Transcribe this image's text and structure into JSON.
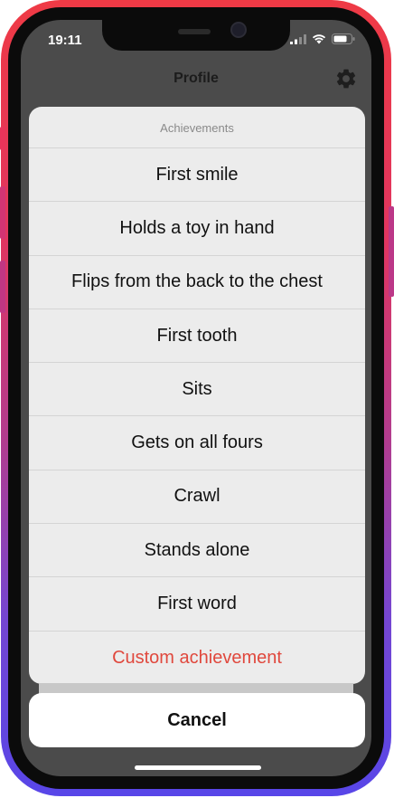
{
  "status_bar": {
    "time": "19:11",
    "icons": [
      "signal-icon",
      "wifi-icon",
      "battery-icon"
    ]
  },
  "nav": {
    "title": "Profile",
    "settings_icon": "gear-icon"
  },
  "action_sheet": {
    "title": "Achievements",
    "items": [
      {
        "label": "First smile"
      },
      {
        "label": "Holds a toy in hand"
      },
      {
        "label": "Flips from the back to the chest"
      },
      {
        "label": "First tooth"
      },
      {
        "label": "Sits"
      },
      {
        "label": "Gets on all fours"
      },
      {
        "label": "Crawl"
      },
      {
        "label": "Stands alone"
      },
      {
        "label": "First word"
      }
    ],
    "custom_label": "Custom achievement",
    "cancel_label": "Cancel"
  },
  "colors": {
    "destructive": "#e0483d",
    "frame_gradient_top": "#ef3a45",
    "frame_gradient_bottom": "#5846e8",
    "dimmed_background": "#4b4b4b",
    "sheet_background": "#ececec"
  }
}
